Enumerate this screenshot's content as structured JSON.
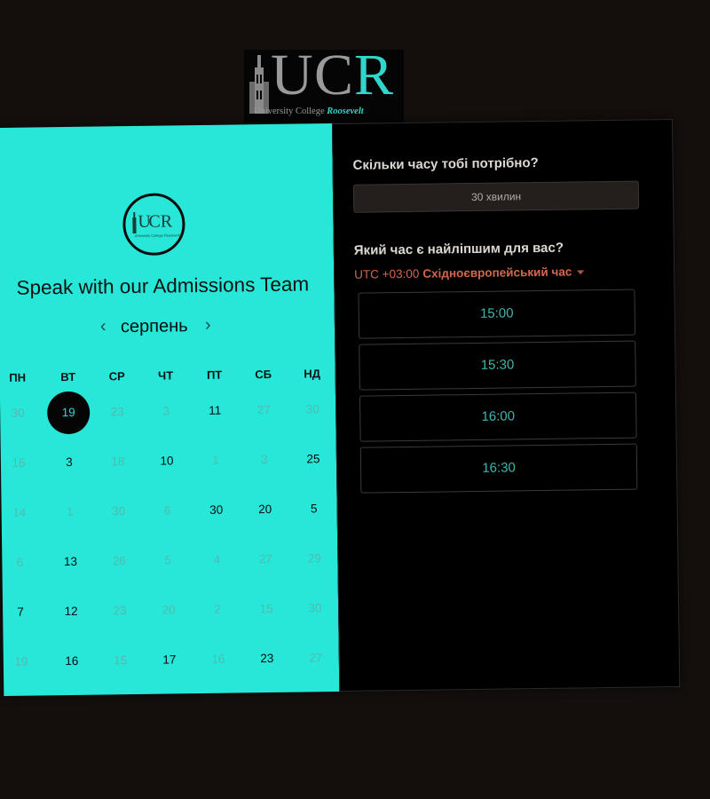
{
  "logo": {
    "letters": [
      "U",
      "C",
      "R"
    ],
    "subtitle": "University College",
    "subtitle_accent": "Roosevelt"
  },
  "booking": {
    "title": "Speak with our Admissions Team",
    "month": "серпень",
    "prev_label": "‹",
    "next_label": "›",
    "weekdays": [
      "ПН",
      "ВТ",
      "СР",
      "ЧТ",
      "ПТ",
      "СБ",
      "НД"
    ],
    "weeks": [
      [
        {
          "d": "30",
          "a": false
        },
        {
          "d": "19",
          "a": true,
          "sel": true
        },
        {
          "d": "23",
          "a": false
        },
        {
          "d": "3",
          "a": false
        },
        {
          "d": "11",
          "a": true
        },
        {
          "d": "27",
          "a": false
        },
        {
          "d": "30",
          "a": false
        }
      ],
      [
        {
          "d": "16",
          "a": false
        },
        {
          "d": "3",
          "a": true
        },
        {
          "d": "18",
          "a": false
        },
        {
          "d": "10",
          "a": true
        },
        {
          "d": "1",
          "a": false
        },
        {
          "d": "3",
          "a": false
        },
        {
          "d": "25",
          "a": true
        }
      ],
      [
        {
          "d": "14",
          "a": false
        },
        {
          "d": "1",
          "a": false
        },
        {
          "d": "30",
          "a": false
        },
        {
          "d": "6",
          "a": false
        },
        {
          "d": "30",
          "a": true
        },
        {
          "d": "20",
          "a": true
        },
        {
          "d": "5",
          "a": true
        }
      ],
      [
        {
          "d": "6",
          "a": false
        },
        {
          "d": "13",
          "a": true
        },
        {
          "d": "26",
          "a": false
        },
        {
          "d": "5",
          "a": false
        },
        {
          "d": "4",
          "a": false
        },
        {
          "d": "27",
          "a": false
        },
        {
          "d": "29",
          "a": false
        }
      ],
      [
        {
          "d": "7",
          "a": true
        },
        {
          "d": "12",
          "a": true
        },
        {
          "d": "23",
          "a": false
        },
        {
          "d": "20",
          "a": false
        },
        {
          "d": "2",
          "a": false
        },
        {
          "d": "15",
          "a": false
        },
        {
          "d": "30",
          "a": false
        }
      ],
      [
        {
          "d": "19",
          "a": false
        },
        {
          "d": "16",
          "a": true
        },
        {
          "d": "15",
          "a": false
        },
        {
          "d": "17",
          "a": true
        },
        {
          "d": "16",
          "a": false
        },
        {
          "d": "23",
          "a": true
        },
        {
          "d": "27",
          "a": false
        }
      ]
    ],
    "duration_question": "Скільки часу тобі потрібно?",
    "duration_value": "30 хвилин",
    "time_question": "Який час є найліпшим для вас?",
    "timezone_offset": "UTC +03:00",
    "timezone_name": "Східноєвропейський час",
    "slots": [
      "15:00",
      "15:30",
      "16:00",
      "16:30"
    ]
  },
  "colors": {
    "left_panel": "#27e8d8",
    "accent": "#2fd6cc",
    "timezone": "#d26650"
  }
}
